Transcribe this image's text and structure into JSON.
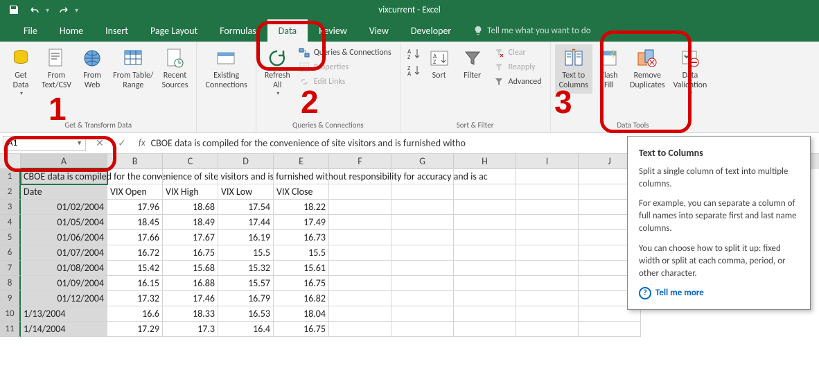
{
  "title": "vixcurrent  -  Excel",
  "tabs": {
    "file": "File",
    "home": "Home",
    "insert": "Insert",
    "page_layout": "Page Layout",
    "formulas": "Formulas",
    "data": "Data",
    "review": "Review",
    "view": "View",
    "developer": "Developer",
    "tell_me": "Tell me what you want to do"
  },
  "ribbon": {
    "group1_label": "Get & Transform Data",
    "get_data": "Get\nData",
    "from_text": "From\nText/CSV",
    "from_web": "From\nWeb",
    "from_table": "From Table/\nRange",
    "recent": "Recent\nSources",
    "existing": "Existing\nConnections",
    "group2_label": "Queries & Connections",
    "refresh": "Refresh\nAll",
    "queries": "Queries & Connections",
    "properties": "Properties",
    "edit_links": "Edit Links",
    "group3_label": "Sort & Filter",
    "sort": "Sort",
    "filter": "Filter",
    "clear": "Clear",
    "reapply": "Reapply",
    "advanced": "Advanced",
    "group4_label": "Data Tools",
    "text_to_columns": "Text to\nColumns",
    "flash_fill": "Flash\nFill",
    "remove_dup": "Remove\nDuplicates",
    "data_val": "Data\nValidation"
  },
  "name_box": "A1",
  "formula": "CBOE data is compiled for the convenience of site visitors and is furnished witho",
  "columns": [
    "A",
    "B",
    "C",
    "D",
    "E",
    "F",
    "G",
    "H",
    "I",
    "J"
  ],
  "grid": {
    "row1": "CBOE data is compiled for the convenience of site visitors and is furnished without responsibility for accuracy and is ac",
    "headers": [
      "Date",
      "VIX Open",
      "VIX High",
      "VIX Low",
      "VIX Close"
    ],
    "rows": [
      {
        "n": 3,
        "date": "01/02/2004",
        "o": "17.96",
        "h": "18.68",
        "l": "17.54",
        "c": "18.22"
      },
      {
        "n": 4,
        "date": "01/05/2004",
        "o": "18.45",
        "h": "18.49",
        "l": "17.44",
        "c": "17.49"
      },
      {
        "n": 5,
        "date": "01/06/2004",
        "o": "17.66",
        "h": "17.67",
        "l": "16.19",
        "c": "16.73"
      },
      {
        "n": 6,
        "date": "01/07/2004",
        "o": "16.72",
        "h": "16.75",
        "l": "15.5",
        "c": "15.5"
      },
      {
        "n": 7,
        "date": "01/08/2004",
        "o": "15.42",
        "h": "15.68",
        "l": "15.32",
        "c": "15.61"
      },
      {
        "n": 8,
        "date": "01/09/2004",
        "o": "16.15",
        "h": "16.88",
        "l": "15.57",
        "c": "16.75"
      },
      {
        "n": 9,
        "date": "01/12/2004",
        "o": "17.32",
        "h": "17.46",
        "l": "16.79",
        "c": "16.82"
      },
      {
        "n": 10,
        "date": "1/13/2004",
        "o": "16.6",
        "h": "18.33",
        "l": "16.53",
        "c": "18.04"
      },
      {
        "n": 11,
        "date": "1/14/2004",
        "o": "17.29",
        "h": "17.3",
        "l": "16.4",
        "c": "16.75"
      }
    ]
  },
  "tooltip": {
    "title": "Text to Columns",
    "p1": "Split a single column of text into multiple columns.",
    "p2": "For example, you can separate a column of full names into separate first and last name columns.",
    "p3": "You can choose how to split it up: fixed width or split at each comma, period, or other character.",
    "link": "Tell me more"
  },
  "annotations": {
    "n1": "1",
    "n2": "2",
    "n3": "3"
  }
}
